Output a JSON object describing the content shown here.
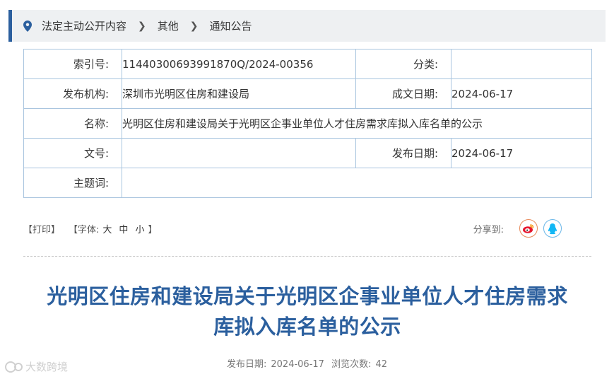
{
  "breadcrumb": {
    "items": [
      "法定主动公开内容",
      "其他",
      "通知公告"
    ],
    "separator": ">"
  },
  "meta": {
    "index_label": "索引号:",
    "index_value": "11440300693991870Q/2024-00356",
    "category_label": "分类:",
    "category_value": "",
    "publisher_label": "发布机构:",
    "publisher_value": "深圳市光明区住房和建设局",
    "created_label": "成文日期:",
    "created_value": "2024-06-17",
    "name_label": "名称:",
    "name_value": "光明区住房和建设局关于光明区企事业单位人才住房需求库拟入库名单的公示",
    "docno_label": "文号:",
    "docno_value": "",
    "published_label": "发布日期:",
    "published_value": "2024-06-17",
    "subject_label": "主题词:",
    "subject_value": ""
  },
  "toolbar": {
    "print": "【打印】",
    "font_prefix": "【字体:",
    "font_large": "大",
    "font_medium": "中",
    "font_small": "小",
    "font_suffix": "】",
    "share_label": "分享到:"
  },
  "article": {
    "title_line1": "光明区住房和建设局关于光明区企事业单位人才住房需求",
    "title_line2": "库拟入库名单的公示",
    "date_label": "发布日期:",
    "date_value": "2024-06-17",
    "views_label": "浏览次数:",
    "views_value": "42"
  },
  "watermark": "大数跨境",
  "colors": {
    "accent": "#2b5f9e",
    "border": "#a9c5df",
    "weibo": "#e6162d",
    "qq": "#12b7f5"
  }
}
